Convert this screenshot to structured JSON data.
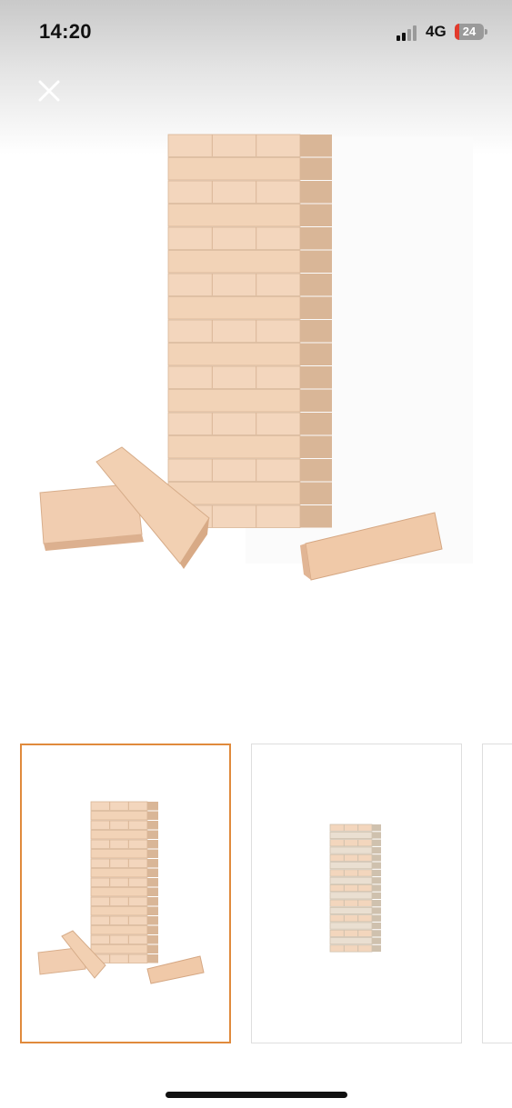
{
  "status": {
    "time": "14:20",
    "network": "4G",
    "battery_level": "24"
  },
  "viewer": {
    "icons": {
      "close": "close-icon",
      "main_image": "jenga-tower-photo"
    },
    "thumbnails": [
      {
        "name": "jenga-tower-with-fallen-blocks",
        "selected": true
      },
      {
        "name": "jenga-tower-plain",
        "selected": false
      },
      {
        "name": "partial-next-thumbnail",
        "selected": false
      }
    ]
  },
  "colors": {
    "accent_selected": "#e08a3c",
    "wood_light": "#f2d3b7",
    "wood_shade": "#d9b697",
    "wood_pale": "#eadfd1"
  }
}
